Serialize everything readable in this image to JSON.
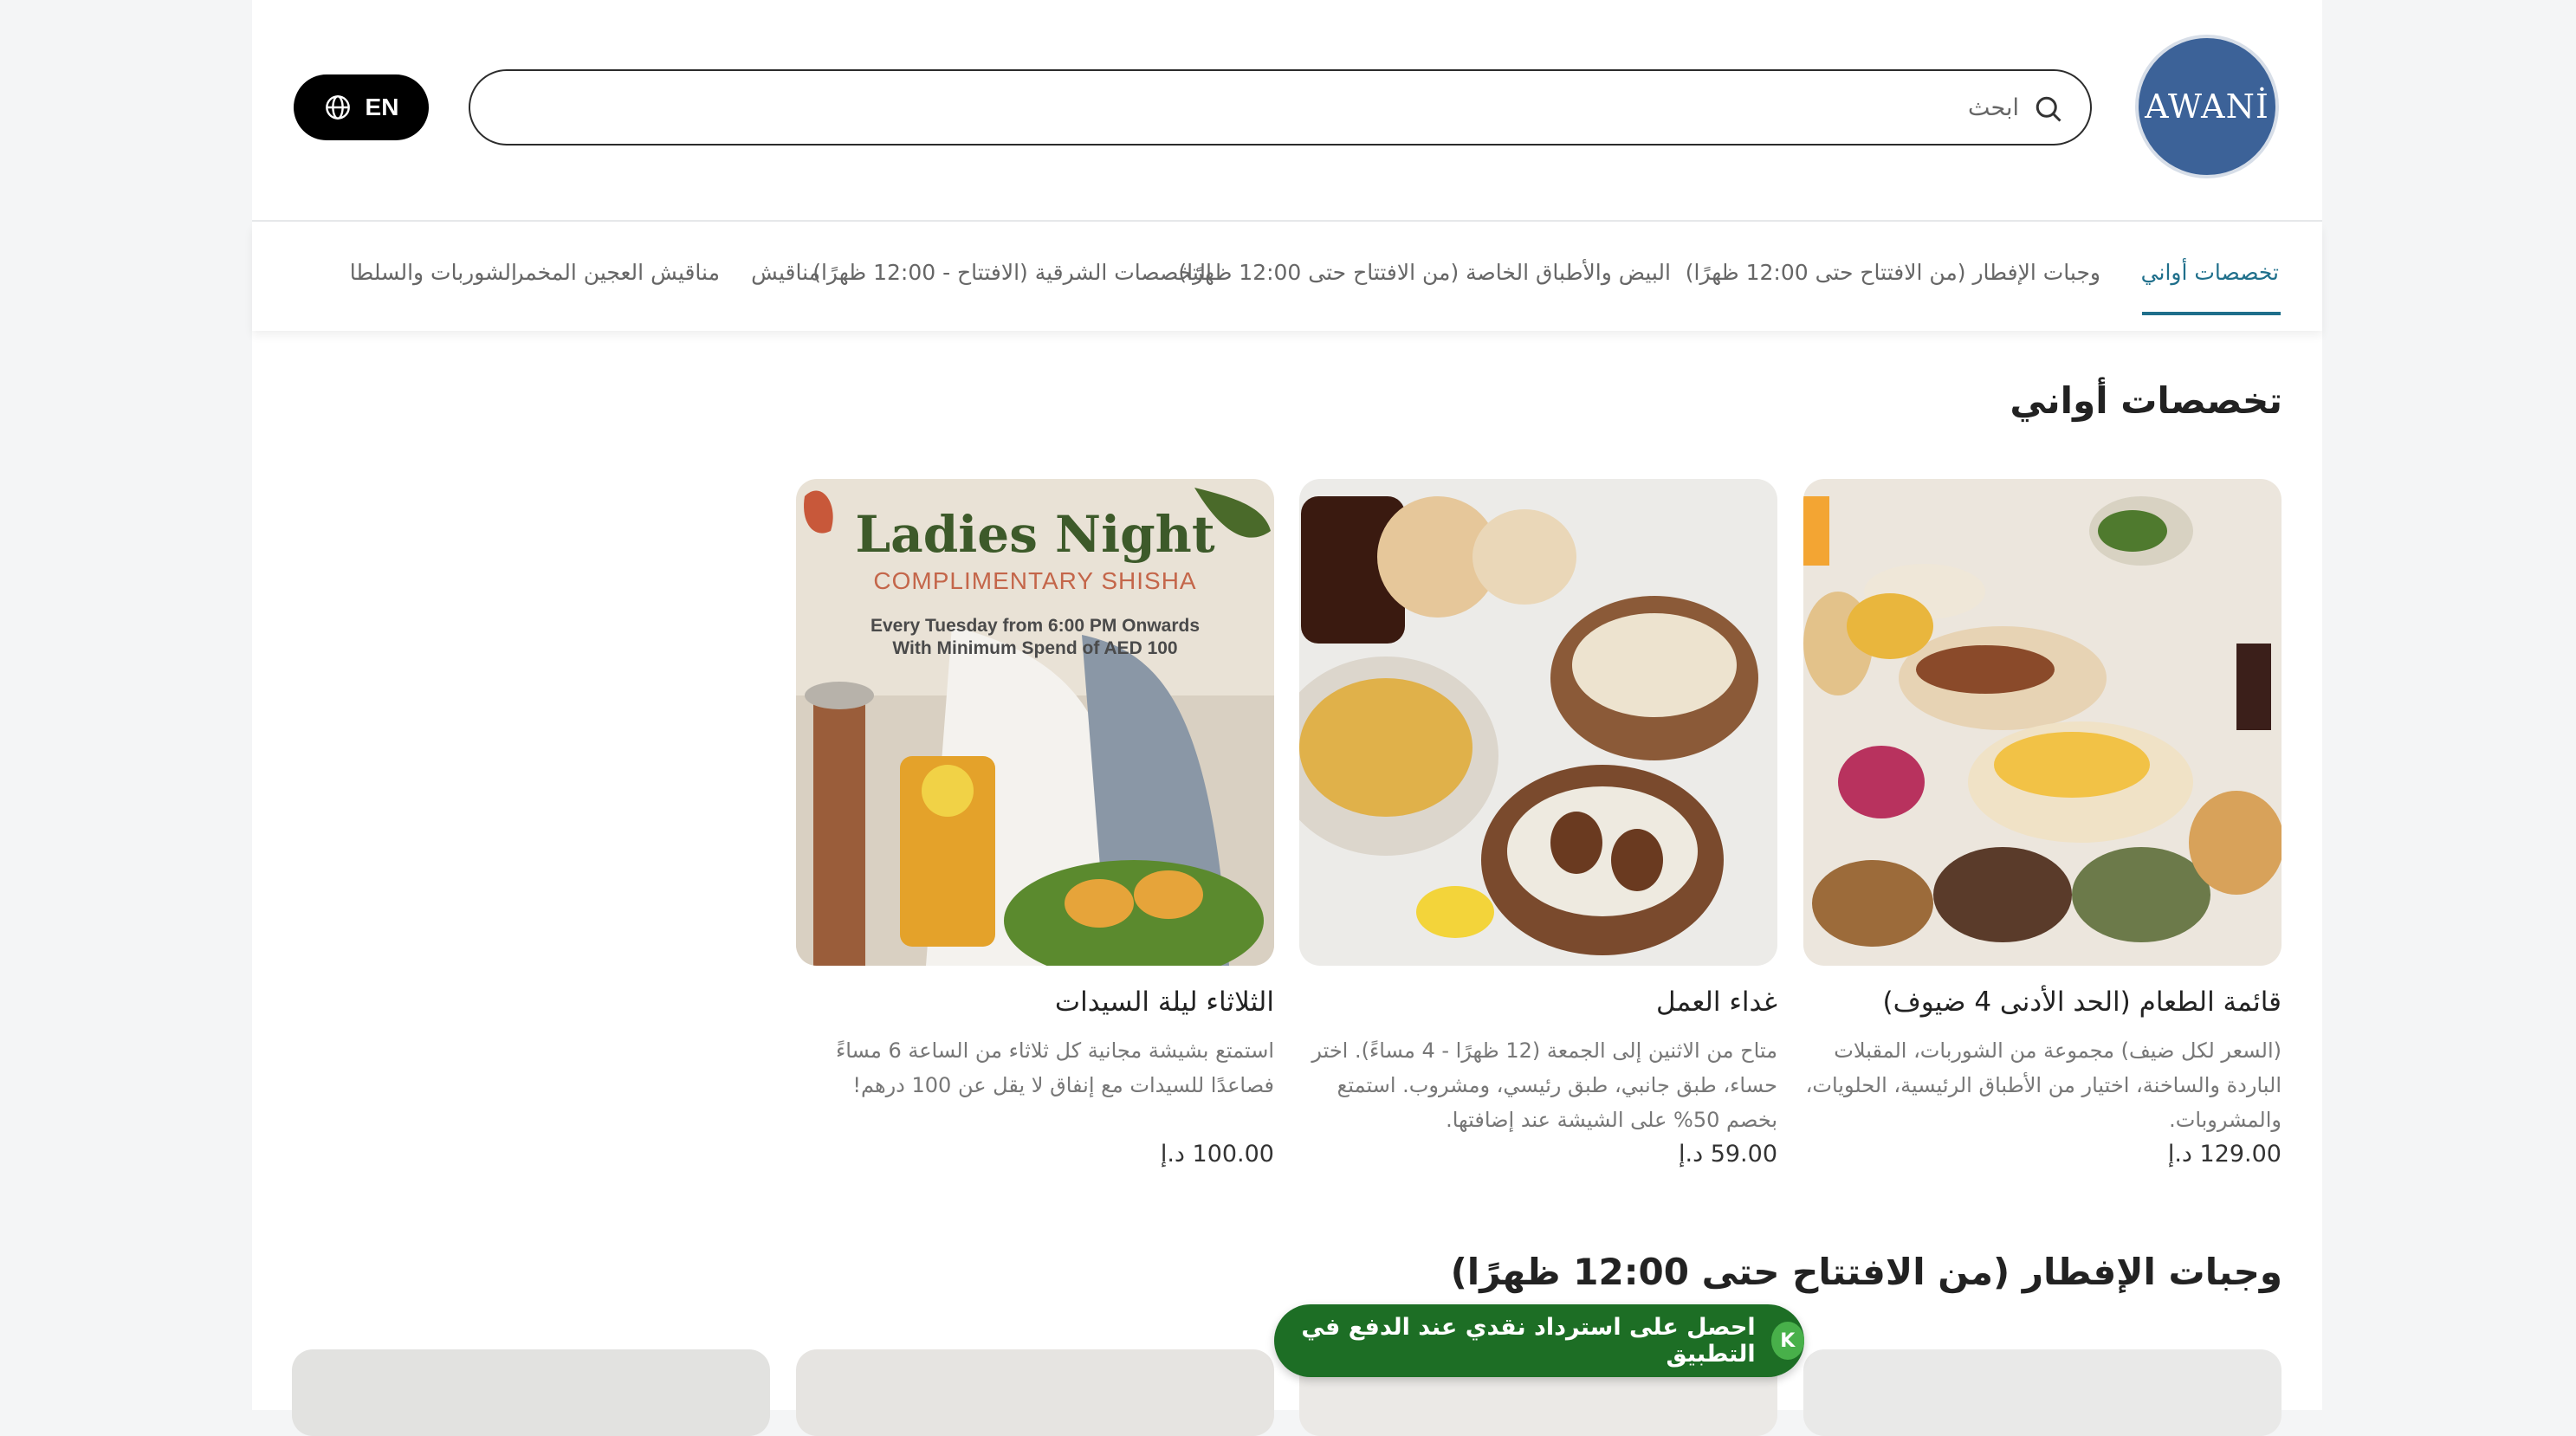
{
  "brand": {
    "logo_text": "AWANİ"
  },
  "search": {
    "placeholder": "ابحث"
  },
  "language": {
    "label": "EN"
  },
  "tabs": [
    {
      "label": "تخصصات أواني",
      "active": true
    },
    {
      "label": "وجبات الإفطار (من الافتتاح حتى 12:00 ظهرًا)"
    },
    {
      "label": "البيض والأطباق الخاصة (من الافتتاح حتى 12:00 ظهرًا)"
    },
    {
      "label": "التخصصات الشرقية (الافتتاح - 12:00 ظهرًا)"
    },
    {
      "label": "مناقيش"
    },
    {
      "label": "مناقيش العجين المخمر"
    },
    {
      "label": "الشوربات والسلطا"
    }
  ],
  "sections": [
    {
      "title": "تخصصات أواني",
      "items": [
        {
          "title": "قائمة الطعام (الحد الأدنى 4 ضيوف)",
          "description": "(السعر لكل ضيف) مجموعة من الشوربات، المقبلات الباردة والساخنة، اختيار من الأطباق الرئيسية، الحلويات، والمشروبات.",
          "price": "129.00 د.إ"
        },
        {
          "title": "غداء العمل",
          "description": "متاح من الاثنين إلى الجمعة (12 ظهرًا - 4 مساءً). اختر حساء، طبق جانبي، طبق رئيسي، ومشروب. استمتع بخصم 50% على الشيشة عند إضافتها.",
          "price": "59.00 د.إ"
        },
        {
          "title": "الثلاثاء ليلة السيدات",
          "description": "استمتع بشيشة مجانية كل ثلاثاء من الساعة 6 مساءً فصاعدًا للسيدات مع إنفاق لا يقل عن 100 درهم!",
          "price": "100.00 د.إ",
          "image_text": {
            "headline": "Ladies Night",
            "sub": "COMPLIMENTARY SHISHA",
            "line1": "Every Tuesday from 6:00 PM Onwards",
            "line2": "With Minimum Spend of AED 100"
          }
        }
      ]
    },
    {
      "title": "وجبات الإفطار (من الافتتاح حتى 12:00 ظهرًا)"
    }
  ],
  "promo": {
    "label": "احصل على استرداد نقدي عند الدفع في التطبيق"
  },
  "colors": {
    "accent": "#1f6f8b",
    "logo_bg": "#3c6298",
    "promo_bg": "#1d6e25"
  }
}
